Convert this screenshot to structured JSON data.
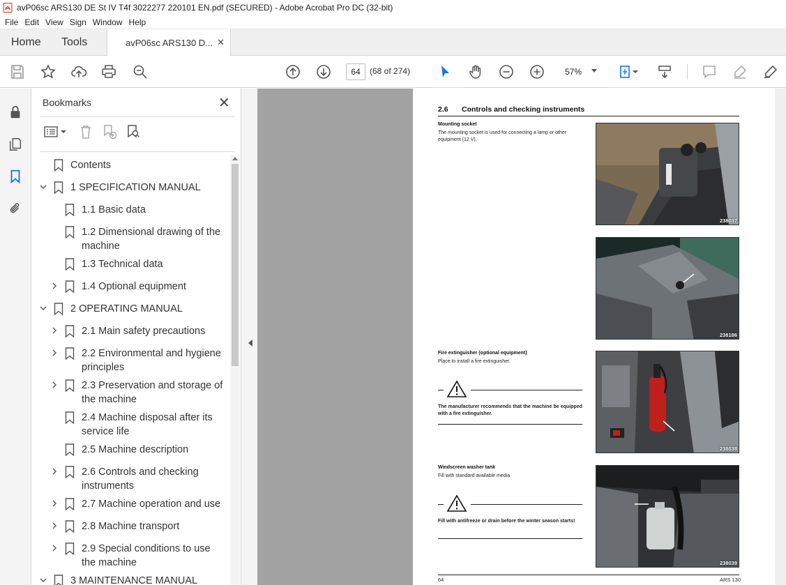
{
  "window": {
    "title": "avP06sc ARS130 DE St IV T4f 3022277 220101 EN.pdf (SECURED) - Adobe Acrobat Pro DC (32-bit)"
  },
  "menu": [
    "File",
    "Edit",
    "View",
    "Sign",
    "Window",
    "Help"
  ],
  "tabs": {
    "home": "Home",
    "tools": "Tools",
    "document": "avP06sc ARS130 D...",
    "close": "✕"
  },
  "toolbar": {
    "page_input": "64",
    "page_count": "(68 of 274)",
    "zoom": "57%"
  },
  "bookmarks": {
    "title": "Bookmarks",
    "close": "✕",
    "items": [
      {
        "label": "Contents"
      },
      {
        "label": "1 SPECIFICATION MANUAL"
      },
      {
        "label": "1.1 Basic data"
      },
      {
        "label": "1.2 Dimensional drawing of the",
        "label2": "machine"
      },
      {
        "label": "1.3 Technical data"
      },
      {
        "label": "1.4 Optional equipment"
      },
      {
        "label": "2 OPERATING MANUAL"
      },
      {
        "label": "2.1 Main safety precautions"
      },
      {
        "label": "2.2 Environmental and hygiene",
        "label2": "principles"
      },
      {
        "label": "2.3 Preservation and storage of",
        "label2": "the machine"
      },
      {
        "label": "2.4 Machine disposal after its",
        "label2": "service life"
      },
      {
        "label": "2.5 Machine description"
      },
      {
        "label": "2.6 Controls and checking",
        "label2": "instruments"
      },
      {
        "label": "2.7 Machine operation and use"
      },
      {
        "label": "2.8 Machine transport"
      },
      {
        "label": "2.9 Special conditions to use",
        "label2": "the machine"
      },
      {
        "label": "3 MAINTENANCE MANUAL"
      }
    ]
  },
  "document": {
    "section_number": "2.6",
    "section_title": "Controls and checking instruments",
    "mounting_socket_head": "Mounting socket",
    "mounting_socket_text": "The mounting socket is used for connecting a lamp or other equipment (12 V).",
    "extinguisher_head": "Fire extinguisher (optional equipment)",
    "extinguisher_text": "Place to install a fire extinguisher.",
    "extinguisher_warning": "The manufacturer recommends that the machine be equipped with a fire extinguisher.",
    "washer_head": "Windscreen washer tank",
    "washer_text": "Fill with standard available media.",
    "washer_warning": "Fill with antifreeze or drain before the winter season starts!",
    "photo_codes": [
      "238037",
      "238186",
      "238038",
      "238039"
    ],
    "footer_page": "64",
    "footer_model": "ARS 130"
  },
  "colors": {
    "accent": "#1473e6",
    "doc_background": "#a3a3a3",
    "pdf_red": "#d9261c"
  }
}
